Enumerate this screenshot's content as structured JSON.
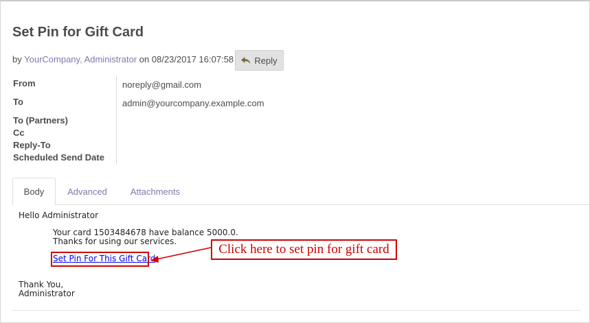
{
  "message": {
    "title": "Set Pin for Gift Card",
    "by_prefix": "by",
    "author": "YourCompany, Administrator",
    "on_prefix": "on",
    "datetime": "08/23/2017 16:07:58",
    "reply_label": "Reply"
  },
  "fields": {
    "from_label": "From",
    "from_value": "noreply@gmail.com",
    "to_label": "To",
    "to_value": "admin@yourcompany.example.com",
    "to_partners_label": "To (Partners)",
    "cc_label": "Cc",
    "reply_to_label": "Reply-To",
    "scheduled_label": "Scheduled Send Date"
  },
  "tabs": [
    {
      "label": "Body",
      "active": true
    },
    {
      "label": "Advanced",
      "active": false
    },
    {
      "label": "Attachments",
      "active": false
    }
  ],
  "body": {
    "greeting": "Hello Administrator",
    "line1": "Your card 1503484678 have balance 5000.0.",
    "line2": "Thanks for using our services.",
    "link_text": "Set Pin For This Gift Card",
    "closing1": "Thank You,",
    "closing2": "Administrator"
  },
  "annotation": {
    "callout_text": "Click here to set pin for gift card",
    "color": "#d00000"
  },
  "colors": {
    "link_purple": "#7c7bad",
    "text": "#4c4c4c",
    "button_bg": "#e2e2e2"
  },
  "icons": {
    "reply": "reply-arrow-icon"
  }
}
